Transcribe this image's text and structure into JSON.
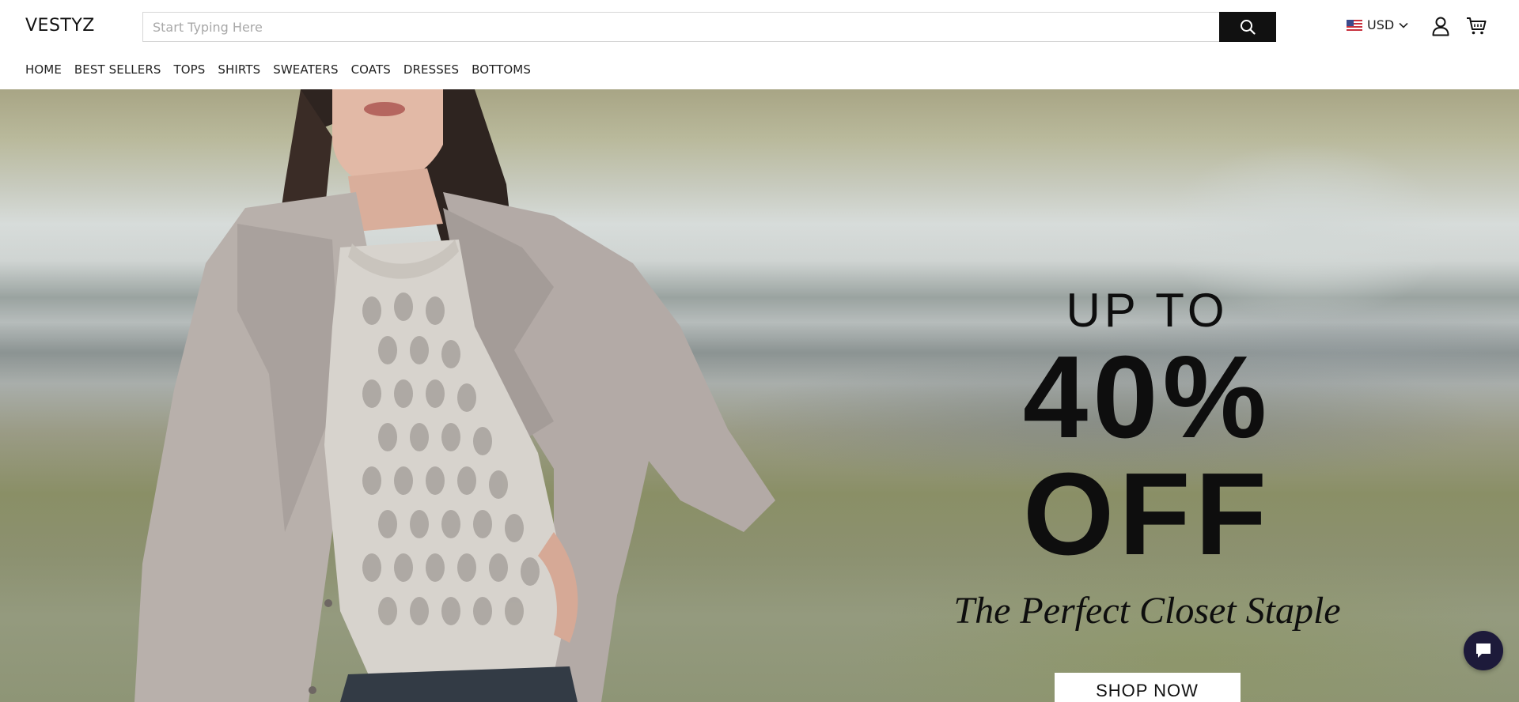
{
  "brand": {
    "logo_text": "VESTYZ"
  },
  "search": {
    "placeholder": "Start Typing Here",
    "value": "",
    "button_icon": "search-icon"
  },
  "currency": {
    "flag": "us-flag-icon",
    "code": "USD",
    "chevron": "chevron-down-icon"
  },
  "header_icons": {
    "account": "user-icon",
    "cart": "cart-icon"
  },
  "nav": {
    "items": [
      {
        "label": "HOME"
      },
      {
        "label": "BEST SELLERS"
      },
      {
        "label": "TOPS"
      },
      {
        "label": "SHIRTS"
      },
      {
        "label": "SWEATERS"
      },
      {
        "label": "COATS"
      },
      {
        "label": "DRESSES"
      },
      {
        "label": "BOTTOMS"
      }
    ]
  },
  "hero": {
    "line1": "UP TO",
    "line2": "40% OFF",
    "tagline": "The Perfect Closet Staple",
    "cta_label": "SHOP NOW"
  },
  "chat": {
    "icon": "chat-icon"
  },
  "colors": {
    "accent": "#111111",
    "chat_bg": "#1d1a3a",
    "coat": "#b3aaa6",
    "background_green": "#8e9576"
  }
}
